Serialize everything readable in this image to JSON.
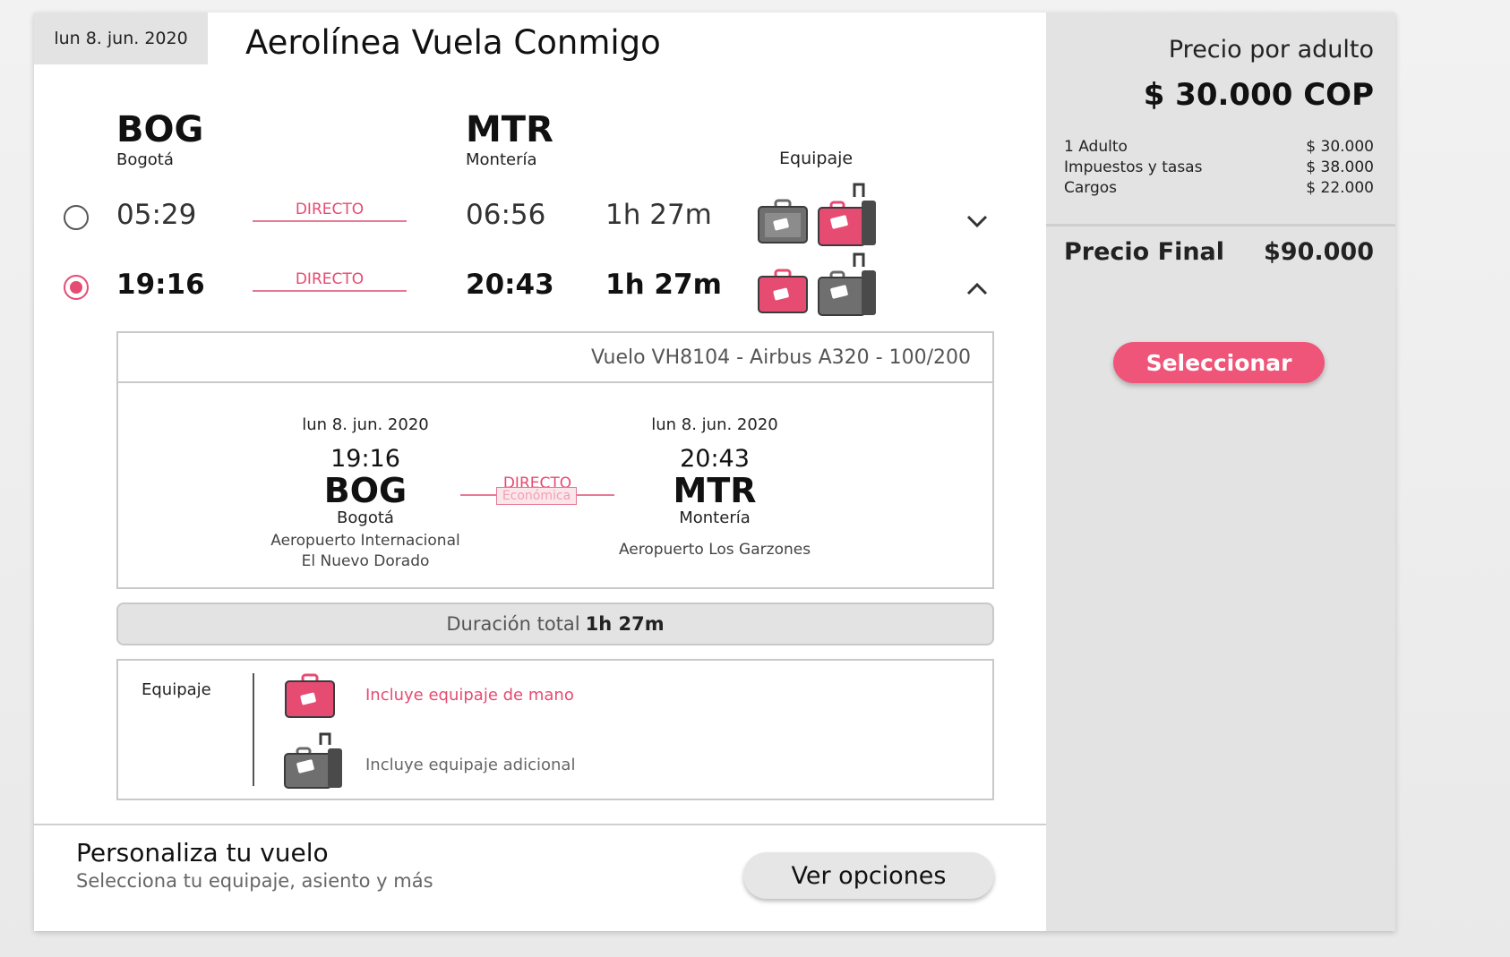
{
  "header": {
    "date": "lun 8. jun. 2020",
    "airline": "Aerolínea Vuela Conmigo"
  },
  "route": {
    "origin_code": "BOG",
    "origin_city": "Bogotá",
    "dest_code": "MTR",
    "dest_city": "Montería",
    "baggage_header": "Equipaje"
  },
  "flights": [
    {
      "selected": false,
      "depart": "05:29",
      "type": "DIRECTO",
      "arrive": "06:56",
      "duration": "1h 27m"
    },
    {
      "selected": true,
      "depart": "19:16",
      "type": "DIRECTO",
      "arrive": "20:43",
      "duration": "1h 27m"
    }
  ],
  "detail": {
    "flight_info": "Vuelo VH8104 - Airbus A320 - 100/200",
    "depart": {
      "date": "lun 8. jun. 2020",
      "time": "19:16",
      "code": "BOG",
      "city": "Bogotá",
      "airport_line1": "Aeropuerto Internacional",
      "airport_line2": "El Nuevo Dorado"
    },
    "arrive": {
      "date": "lun 8. jun. 2020",
      "time": "20:43",
      "code": "MTR",
      "city": "Montería",
      "airport": "Aeropuerto Los Garzones"
    },
    "type": "DIRECTO",
    "cabin": "Económica",
    "duration_label": "Duración total",
    "duration_value": "1h 27m"
  },
  "baggage": {
    "title": "Equipaje",
    "carry_on": "Incluye equipaje de mano",
    "additional": "Incluye equipaje adicional"
  },
  "customize": {
    "title": "Personaliza tu vuelo",
    "subtitle": "Selecciona tu equipaje, asiento y más",
    "button": "Ver opciones"
  },
  "pricing": {
    "label": "Precio por adulto",
    "price": "$ 30.000 COP",
    "breakdown": [
      {
        "label": "1 Adulto",
        "value": "$ 30.000"
      },
      {
        "label": "Impuestos y tasas",
        "value": "$ 38.000"
      },
      {
        "label": "Cargos",
        "value": "$ 22.000"
      }
    ],
    "final_label": "Precio Final",
    "final_value": "$90.000",
    "select_button": "Seleccionar"
  },
  "colors": {
    "accent": "#e64b72",
    "bag_grey": "#6a6a6a",
    "panel": "#e3e3e3"
  },
  "icons": [
    "suitcase-icon",
    "carry-on-bag-icon",
    "chevron-down-icon",
    "chevron-up-icon"
  ]
}
